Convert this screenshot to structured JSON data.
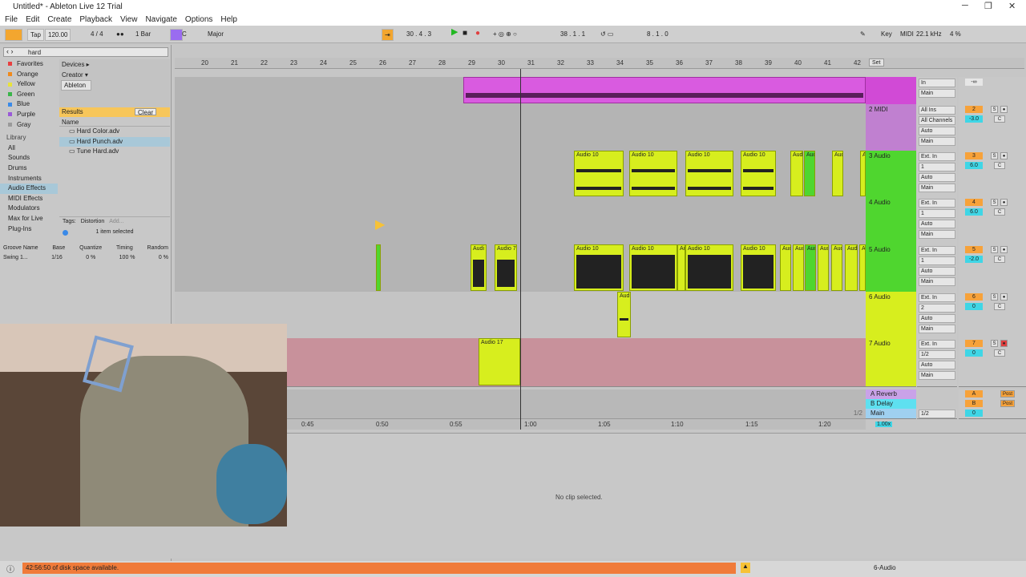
{
  "window": {
    "title": "Untitled* - Ableton Live 12 Trial"
  },
  "menu": [
    "File",
    "Edit",
    "Create",
    "Playback",
    "View",
    "Navigate",
    "Options",
    "Help"
  ],
  "control": {
    "tap": "Tap",
    "tempo": "120.00",
    "signature": "4 / 4",
    "quantize": "1 Bar",
    "key": "C",
    "scale": "Major",
    "position": "30 . 4 . 3",
    "loop_start": "38 . 1 . 1",
    "loop_length": "8 . 1 . 0",
    "key_label": "Key",
    "midi_label": "MIDI",
    "sample_rate": "22.1 kHz",
    "cpu": "4 %"
  },
  "browser": {
    "search_value": "hard",
    "collections": [
      {
        "label": "Favorites",
        "color": "#e84040"
      },
      {
        "label": "Orange",
        "color": "#f08a1c"
      },
      {
        "label": "Yellow",
        "color": "#e8e23a"
      },
      {
        "label": "Green",
        "color": "#3ab54a"
      },
      {
        "label": "Blue",
        "color": "#3a8ae8"
      },
      {
        "label": "Purple",
        "color": "#9a5ad8"
      },
      {
        "label": "Gray",
        "color": "#9a9a9a"
      }
    ],
    "library_header": "Library",
    "library": [
      "All",
      "Sounds",
      "Drums",
      "Instruments",
      "Audio Effects",
      "MIDI Effects",
      "Modulators",
      "Max for Live",
      "Plug-Ins"
    ],
    "library_selected": "Audio Effects",
    "filter_devices": "Devices ▸",
    "filter_creator": "Creator ▾",
    "filter_ableton": "Ableton",
    "results_label": "Results",
    "clear_label": "Clear",
    "name_header": "Name",
    "results": [
      "Hard Color.adv",
      "Hard Punch.adv",
      "Tune Hard.adv"
    ],
    "result_selected": "Hard Punch.adv",
    "tags_label": "Tags:",
    "tag": "Distortion",
    "tag_add": "Add...",
    "items_selected": "1 item selected"
  },
  "groove": {
    "headers": [
      "Groove Name",
      "Base",
      "Quantize",
      "Timing",
      "Random"
    ],
    "row": {
      "name": "Swing 1...",
      "base": "1/16",
      "quantize": "0 %",
      "timing": "100 %",
      "random": "0 %"
    }
  },
  "ruler": {
    "bars": [
      "20",
      "21",
      "22",
      "23",
      "24",
      "25",
      "26",
      "27",
      "28",
      "29",
      "30",
      "31",
      "32",
      "33",
      "34",
      "35",
      "36",
      "37",
      "38",
      "39",
      "40",
      "41",
      "42"
    ],
    "set_label": "Set",
    "times": [
      "0:45",
      "0:50",
      "0:55",
      "1:00",
      "1:05",
      "1:10",
      "1:15",
      "1:20"
    ],
    "page": "1/2"
  },
  "tracks": [
    {
      "name": "",
      "color": "#d14ad6",
      "input": "In",
      "monitor_auto": "Auto",
      "monitor_off": "Off",
      "output": "Main",
      "num": "",
      "volume": "-∞",
      "pan": ""
    },
    {
      "name": "2 MIDI",
      "color": "#c080d0",
      "input": "All Ins",
      "channel": "All Channels",
      "monitor_auto": "Auto",
      "monitor_off": "Off",
      "output": "Main",
      "num": "2",
      "volume": "-3.0",
      "pan": "C"
    },
    {
      "name": "3 Audio",
      "color": "#4fd62f",
      "input": "Ext. In",
      "channel": "1",
      "monitor_auto": "Auto",
      "monitor_off": "Off",
      "output": "Main",
      "num": "3",
      "volume": "6.0",
      "pan": "C"
    },
    {
      "name": "4 Audio",
      "color": "#4fd62f",
      "input": "Ext. In",
      "channel": "1",
      "monitor_auto": "Auto",
      "monitor_off": "Off",
      "output": "Main",
      "num": "4",
      "volume": "6.0",
      "pan": "C"
    },
    {
      "name": "5 Audio",
      "color": "#4fd62f",
      "input": "Ext. In",
      "channel": "1",
      "monitor_auto": "Auto",
      "monitor_off": "Off",
      "output": "Main",
      "num": "5",
      "volume": "-2.0",
      "pan": "C"
    },
    {
      "name": "6 Audio",
      "color": "#d7ee1e",
      "input": "Ext. In",
      "channel": "2",
      "monitor_auto": "Auto",
      "monitor_off": "Off",
      "output": "Main",
      "num": "6",
      "volume": "0",
      "pan": "C"
    },
    {
      "name": "7 Audio",
      "color": "#d7ee1e",
      "input": "Ext. In",
      "channel": "1/2",
      "monitor_auto": "Auto",
      "monitor_off": "Off",
      "output": "Main",
      "num": "7",
      "volume": "0",
      "pan": "C"
    }
  ],
  "returns": [
    {
      "name": "A Reverb",
      "color": "#c9a2e8",
      "num": "A",
      "post": "Post"
    },
    {
      "name": "B Delay",
      "color": "#5ee0f0",
      "num": "B",
      "post": "Post"
    },
    {
      "name": "Main",
      "color": "#9fd0f0",
      "num": "",
      "post": "",
      "output": "1/2",
      "volume": "0"
    }
  ],
  "clip_names": {
    "audio10": "Audio 10",
    "audio7": "Audio 7",
    "audio17": "Audio 17",
    "audio_short": "Audi",
    "aud": "Aud",
    "au": "Au",
    "a": "A"
  },
  "zoom": "1.00x",
  "detail": {
    "no_clip": "No clip selected."
  },
  "status": {
    "disk": "42:56:50 of disk space available.",
    "track_select": "6-Audio"
  }
}
